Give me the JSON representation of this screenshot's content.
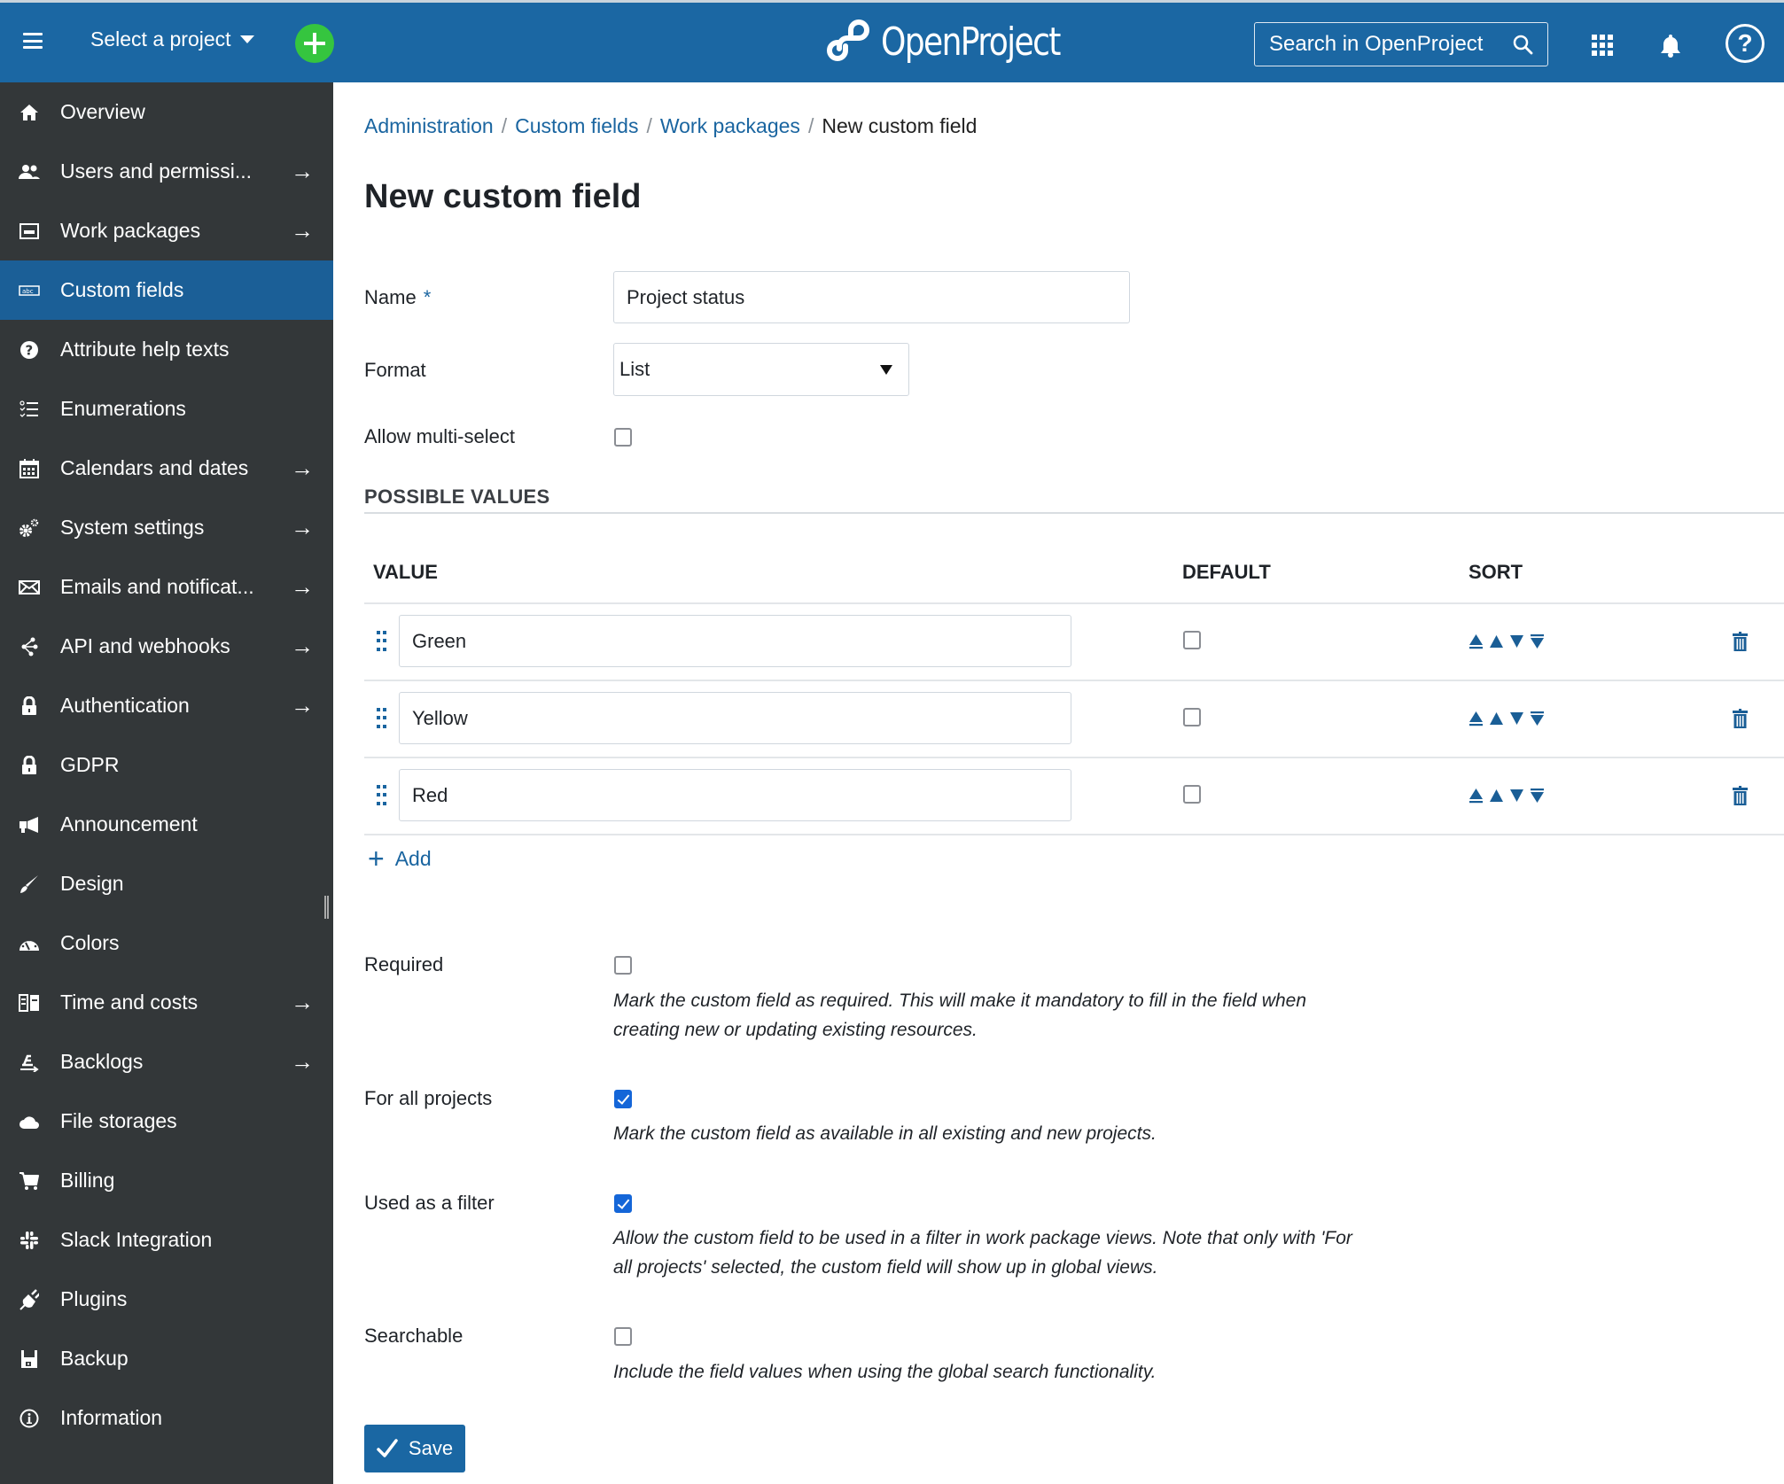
{
  "header": {
    "menu_icon": "hamburger-icon",
    "project_select_label": "Select a project",
    "add_icon": "plus-icon",
    "logo_text": "OpenProject",
    "search_placeholder": "Search in OpenProject",
    "colors": {
      "header_bg": "#1b67a3",
      "add_button": "#35c53f"
    }
  },
  "sidebar": {
    "colors": {
      "bg": "#333739",
      "active_bg": "#1b5f97"
    },
    "items": [
      {
        "label": "Overview",
        "icon": "home-icon",
        "arrow": false,
        "active": false
      },
      {
        "label": "Users and permissi...",
        "icon": "users-icon",
        "arrow": true,
        "active": false
      },
      {
        "label": "Work packages",
        "icon": "work-packages-icon",
        "arrow": true,
        "active": false
      },
      {
        "label": "Custom fields",
        "icon": "custom-fields-icon",
        "arrow": false,
        "active": true
      },
      {
        "label": "Attribute help texts",
        "icon": "help-circle-icon",
        "arrow": false,
        "active": false
      },
      {
        "label": "Enumerations",
        "icon": "checklist-icon",
        "arrow": false,
        "active": false
      },
      {
        "label": "Calendars and dates",
        "icon": "calendar-icon",
        "arrow": true,
        "active": false
      },
      {
        "label": "System settings",
        "icon": "settings-icon",
        "arrow": true,
        "active": false
      },
      {
        "label": "Emails and notificat...",
        "icon": "mail-icon",
        "arrow": true,
        "active": false
      },
      {
        "label": "API and webhooks",
        "icon": "api-icon",
        "arrow": true,
        "active": false
      },
      {
        "label": "Authentication",
        "icon": "lock-icon",
        "arrow": true,
        "active": false
      },
      {
        "label": "GDPR",
        "icon": "lock-icon",
        "arrow": false,
        "active": false
      },
      {
        "label": "Announcement",
        "icon": "megaphone-icon",
        "arrow": false,
        "active": false
      },
      {
        "label": "Design",
        "icon": "brush-icon",
        "arrow": false,
        "active": false
      },
      {
        "label": "Colors",
        "icon": "gauge-icon",
        "arrow": false,
        "active": false
      },
      {
        "label": "Time and costs",
        "icon": "budget-icon",
        "arrow": true,
        "active": false
      },
      {
        "label": "Backlogs",
        "icon": "backlogs-icon",
        "arrow": true,
        "active": false
      },
      {
        "label": "File storages",
        "icon": "cloud-icon",
        "arrow": false,
        "active": false
      },
      {
        "label": "Billing",
        "icon": "cart-icon",
        "arrow": false,
        "active": false
      },
      {
        "label": "Slack Integration",
        "icon": "slack-icon",
        "arrow": false,
        "active": false
      },
      {
        "label": "Plugins",
        "icon": "plug-icon",
        "arrow": false,
        "active": false
      },
      {
        "label": "Backup",
        "icon": "save-disk-icon",
        "arrow": false,
        "active": false
      },
      {
        "label": "Information",
        "icon": "info-icon",
        "arrow": false,
        "active": false
      }
    ]
  },
  "breadcrumb": {
    "items": [
      "Administration",
      "Custom fields",
      "Work packages"
    ],
    "separator": "/",
    "current": "New custom field"
  },
  "page_title": "New custom field",
  "form": {
    "name": {
      "label": "Name",
      "required_mark": "*",
      "value": "Project status"
    },
    "format": {
      "label": "Format",
      "value": "List"
    },
    "multi_select": {
      "label": "Allow multi-select",
      "checked": false
    },
    "possible_values": {
      "title": "POSSIBLE VALUES",
      "columns": {
        "value": "VALUE",
        "default": "DEFAULT",
        "sort": "SORT"
      },
      "rows": [
        {
          "value": "Green",
          "default": false
        },
        {
          "value": "Yellow",
          "default": false
        },
        {
          "value": "Red",
          "default": false
        }
      ],
      "sort_actions": [
        "move-to-top",
        "move-up",
        "move-down",
        "move-to-bottom"
      ],
      "add_label": "Add"
    },
    "required": {
      "label": "Required",
      "checked": false,
      "help": "Mark the custom field as required. This will make it mandatory to fill in the field when creating new or updating existing resources."
    },
    "for_all_projects": {
      "label": "For all projects",
      "checked": true,
      "help": "Mark the custom field as available in all existing and new projects."
    },
    "used_as_filter": {
      "label": "Used as a filter",
      "checked": true,
      "help": "Allow the custom field to be used in a filter in work package views. Note that only with 'For all projects' selected, the custom field will show up in global views."
    },
    "searchable": {
      "label": "Searchable",
      "checked": false,
      "help": "Include the field values when using the global search functionality."
    },
    "save_label": "Save"
  },
  "colors": {
    "link": "#1a65a0",
    "checkbox_checked": "#1466d8",
    "primary_button": "#1a67a3"
  }
}
